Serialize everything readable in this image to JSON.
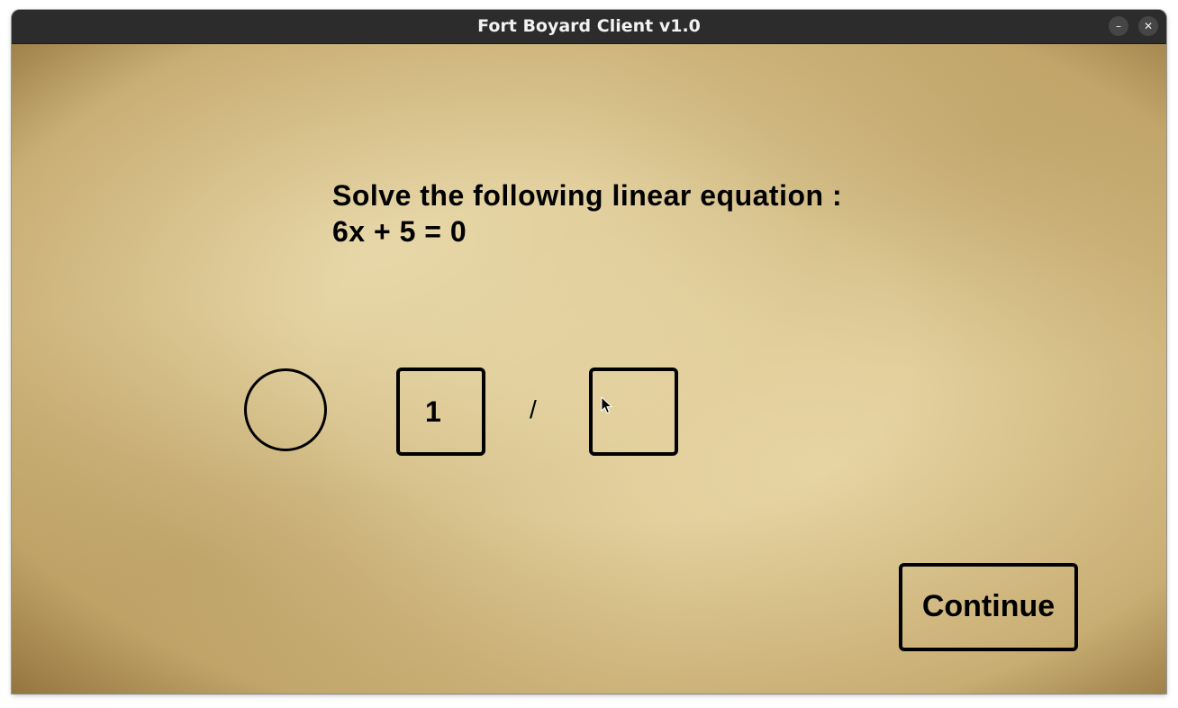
{
  "window": {
    "title": "Fort Boyard Client v1.0",
    "minimize_label": "–",
    "close_label": "✕"
  },
  "question": {
    "line1": "Solve the following linear equation :",
    "line2": "6x + 5 = 0"
  },
  "answer": {
    "sign_value": "",
    "numerator_value": "1",
    "fraction_separator": "/",
    "denominator_value": ""
  },
  "actions": {
    "continue_label": "Continue"
  },
  "icons": {
    "minimize": "minimize-icon",
    "close": "close-icon",
    "cursor": "mouse-pointer-icon"
  },
  "colors": {
    "titlebar": "#2c2c2c",
    "background": "#dcc893",
    "ink": "#000000"
  }
}
